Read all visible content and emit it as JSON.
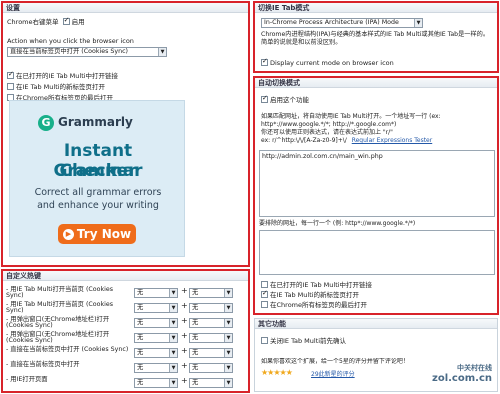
{
  "settings_panel": {
    "title": "设置",
    "context_menu_label": "Chrome右键菜单",
    "enable_label": "启用",
    "action_label": "Action when you click the browser icon",
    "action_select": "直接在当前标签页中打开 (Cookies Sync)",
    "options": [
      {
        "label": "在已打开的IE Tab Multi中打开链接",
        "checked": true
      },
      {
        "label": "在IE Tab Multi的新标签页打开",
        "checked": false
      },
      {
        "label": "在Chrome所有标签页的最后打开",
        "checked": false
      }
    ]
  },
  "ad": {
    "brand": "Grammarly",
    "headline_1": "Instant Grammar",
    "headline_2": "Checker",
    "body_1": "Correct all grammar errors",
    "body_2": "and enhance your writing",
    "button": "Try Now"
  },
  "hotkeys_panel": {
    "title": "自定义热键",
    "rows": [
      {
        "label": "- 用IE Tab Multi打开当前页 (Cookies Sync)",
        "key1": "无",
        "key2": "无"
      },
      {
        "label": "- 用IE Tab Multi打开当前页 (Cookies Sync)",
        "key1": "无",
        "key2": "无"
      },
      {
        "label": "- 用弹出窗口(无Chrome地址栏)打开 (Cookies Sync)",
        "key1": "无",
        "key2": "无"
      },
      {
        "label": "- 用弹出窗口(无Chrome地址栏)打开 (Cookies Sync)",
        "key1": "无",
        "key2": "无"
      },
      {
        "label": "- 直接在当前标签页中打开 (Cookies Sync)",
        "key1": "无",
        "key2": "无"
      },
      {
        "label": "- 直接在当前标签页中打开",
        "key1": "无",
        "key2": "无"
      },
      {
        "label": "- 用IE打开页面",
        "key1": "无",
        "key2": "无"
      }
    ]
  },
  "switch_panel": {
    "title": "切换IE Tab模式",
    "mode_select": "In-Chrome Process Architecture (IPA) Mode",
    "desc": "Chrome内进程结构(IPA)与经典的基本样式的IE Tab Multi或其他IE Tab是一样的。简单的说就是和以前没区别。",
    "display_label": "Display current mode on browser icon",
    "display_checked": true
  },
  "auto_panel": {
    "title": "自动切换模式",
    "enable_label": "启用这个功能",
    "enable_checked": true,
    "help_1": "如果匹配网址，将自动使用IE Tab Multi打开。一个地址写一行 (ex: http*://www.google.*/*; http://*.google.com*)",
    "help_2": "你还可以使用正则表达式，请在表达式前加上 \"r/\"",
    "help_3": "ex: r/^http:\\/\\/[A-Za-z0-9]+\\/",
    "regex_link": "Regular Expressions Tester",
    "urls_value": "http://admin.zol.com.cn/main_win.php",
    "exclude_label": "要排除的网址，每一行一个 (例: http*://www.google.*/*)",
    "exclude_value": "",
    "options": [
      {
        "label": "在已打开的IE Tab Multi中打开链接",
        "checked": false
      },
      {
        "label": "在IE Tab Multi的新标签页打开",
        "checked": true
      },
      {
        "label": "在Chrome所有标签页的最后打开",
        "checked": false
      }
    ]
  },
  "other_panel": {
    "title": "其它功能",
    "confirm_label": "关闭IE Tab Multi前先确认",
    "rate_text": "如果你喜欢这个扩展，给一个5星的评分并留下评论吧！",
    "reviews_link": "29此新星的评分"
  },
  "watermark": {
    "line1": "中关村在线",
    "line2": "zol.com.cn"
  }
}
